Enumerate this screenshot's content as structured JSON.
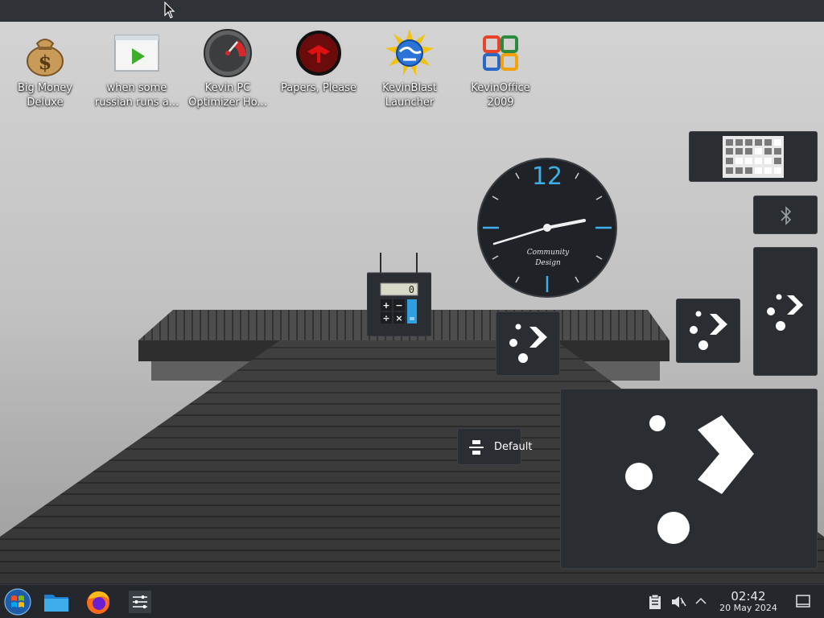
{
  "desktop": {
    "icons": [
      {
        "label": "Big Money Deluxe",
        "icon": "money-bag-icon"
      },
      {
        "label": "when some russian runs a...",
        "icon": "video-player-icon"
      },
      {
        "label": "Kevin PC Optimizer Ho...",
        "icon": "speedometer-icon"
      },
      {
        "label": "Papers, Please",
        "icon": "papers-please-icon"
      },
      {
        "label": "KevinBlast Launcher",
        "icon": "globe-sun-icon"
      },
      {
        "label": "KevinOffice 2009",
        "icon": "office-suite-icon"
      }
    ]
  },
  "widgets": {
    "clock": {
      "numeral": "12",
      "brand_line1": "Community",
      "brand_line2": "Design",
      "accent": "#3daee9"
    },
    "calculator": {
      "display": "0",
      "keys": [
        "+",
        "−",
        "÷",
        "×",
        "="
      ]
    },
    "default_label": "Default"
  },
  "taskbar": {
    "time": "02:42",
    "date": "20 May 2024"
  },
  "colors": {
    "panel": "#2f3237",
    "card": "#2a2e32",
    "accent": "#3daee9"
  }
}
